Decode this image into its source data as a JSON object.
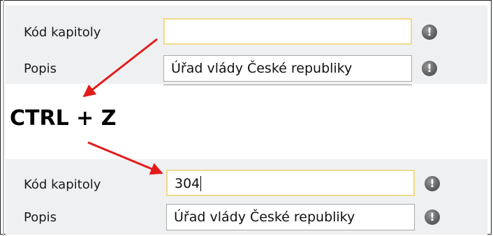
{
  "top_form": {
    "kod_label": "Kód kapitoly",
    "kod_value": "",
    "popis_label": "Popis",
    "popis_value": "Úřad vlády České republiky"
  },
  "shortcut": "CTRL + Z",
  "bottom_form": {
    "kod_label": "Kód kapitoly",
    "kod_value": "304",
    "popis_label": "Popis",
    "popis_value": "Úřad vlády České republiky"
  },
  "icons": {
    "info": "info-icon",
    "arrow": "red-arrow-icon"
  },
  "colors": {
    "arrow": "#e31b1b",
    "active_field_border": "#f1d98a",
    "panel_bg": "#eef0f2"
  },
  "info_glyph": "!"
}
